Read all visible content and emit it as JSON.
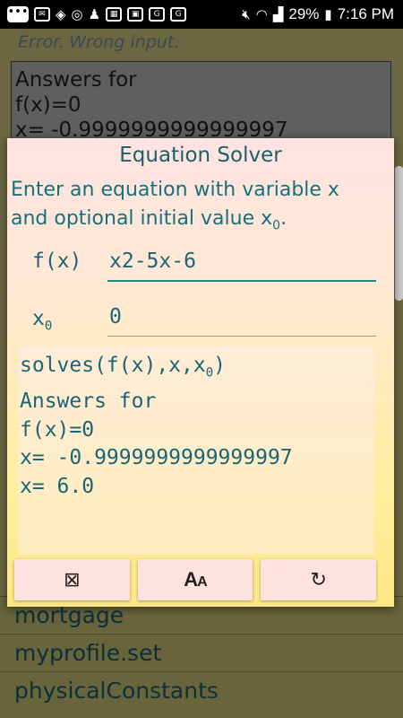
{
  "status_bar": {
    "battery": "29%",
    "time": "7:16 PM",
    "icons": [
      "more-icon",
      "mail-icon",
      "diamond-icon",
      "chrome-icon",
      "piece-icon",
      "calendar-icon",
      "image-icon",
      "google-icon",
      "google-icon",
      "mute-icon",
      "wifi-icon",
      "signal-icon",
      "battery-icon"
    ]
  },
  "background": {
    "error_text": "Error. Wrong input.",
    "card_lines": [
      "Answers for",
      "f(x)=0",
      "x= -0.9999999999999997"
    ],
    "list_items": [
      "mortgage",
      "myprofile.set",
      "physicalConstants"
    ]
  },
  "dialog": {
    "title": "Equation Solver",
    "instruction_line1": "Enter an equation with variable x",
    "instruction_line2_prefix": "and optional initial value x",
    "instruction_sub": "0",
    "instruction_suffix": ".",
    "fx_label": "f(x)",
    "fx_value": "x2-5x-6",
    "x0_label": "x",
    "x0_sub": "0",
    "x0_value": "0",
    "output_line1_prefix": "solves(f(x),x,x",
    "output_line1_sub": "0",
    "output_line1_suffix": ")",
    "output_lines": [
      "Answers for",
      "f(x)=0",
      "x= -0.9999999999999997",
      "x= 6.0"
    ],
    "buttons": {
      "clear": "⊠",
      "font_big": "A",
      "font_small": "A",
      "refresh": "↻"
    }
  }
}
